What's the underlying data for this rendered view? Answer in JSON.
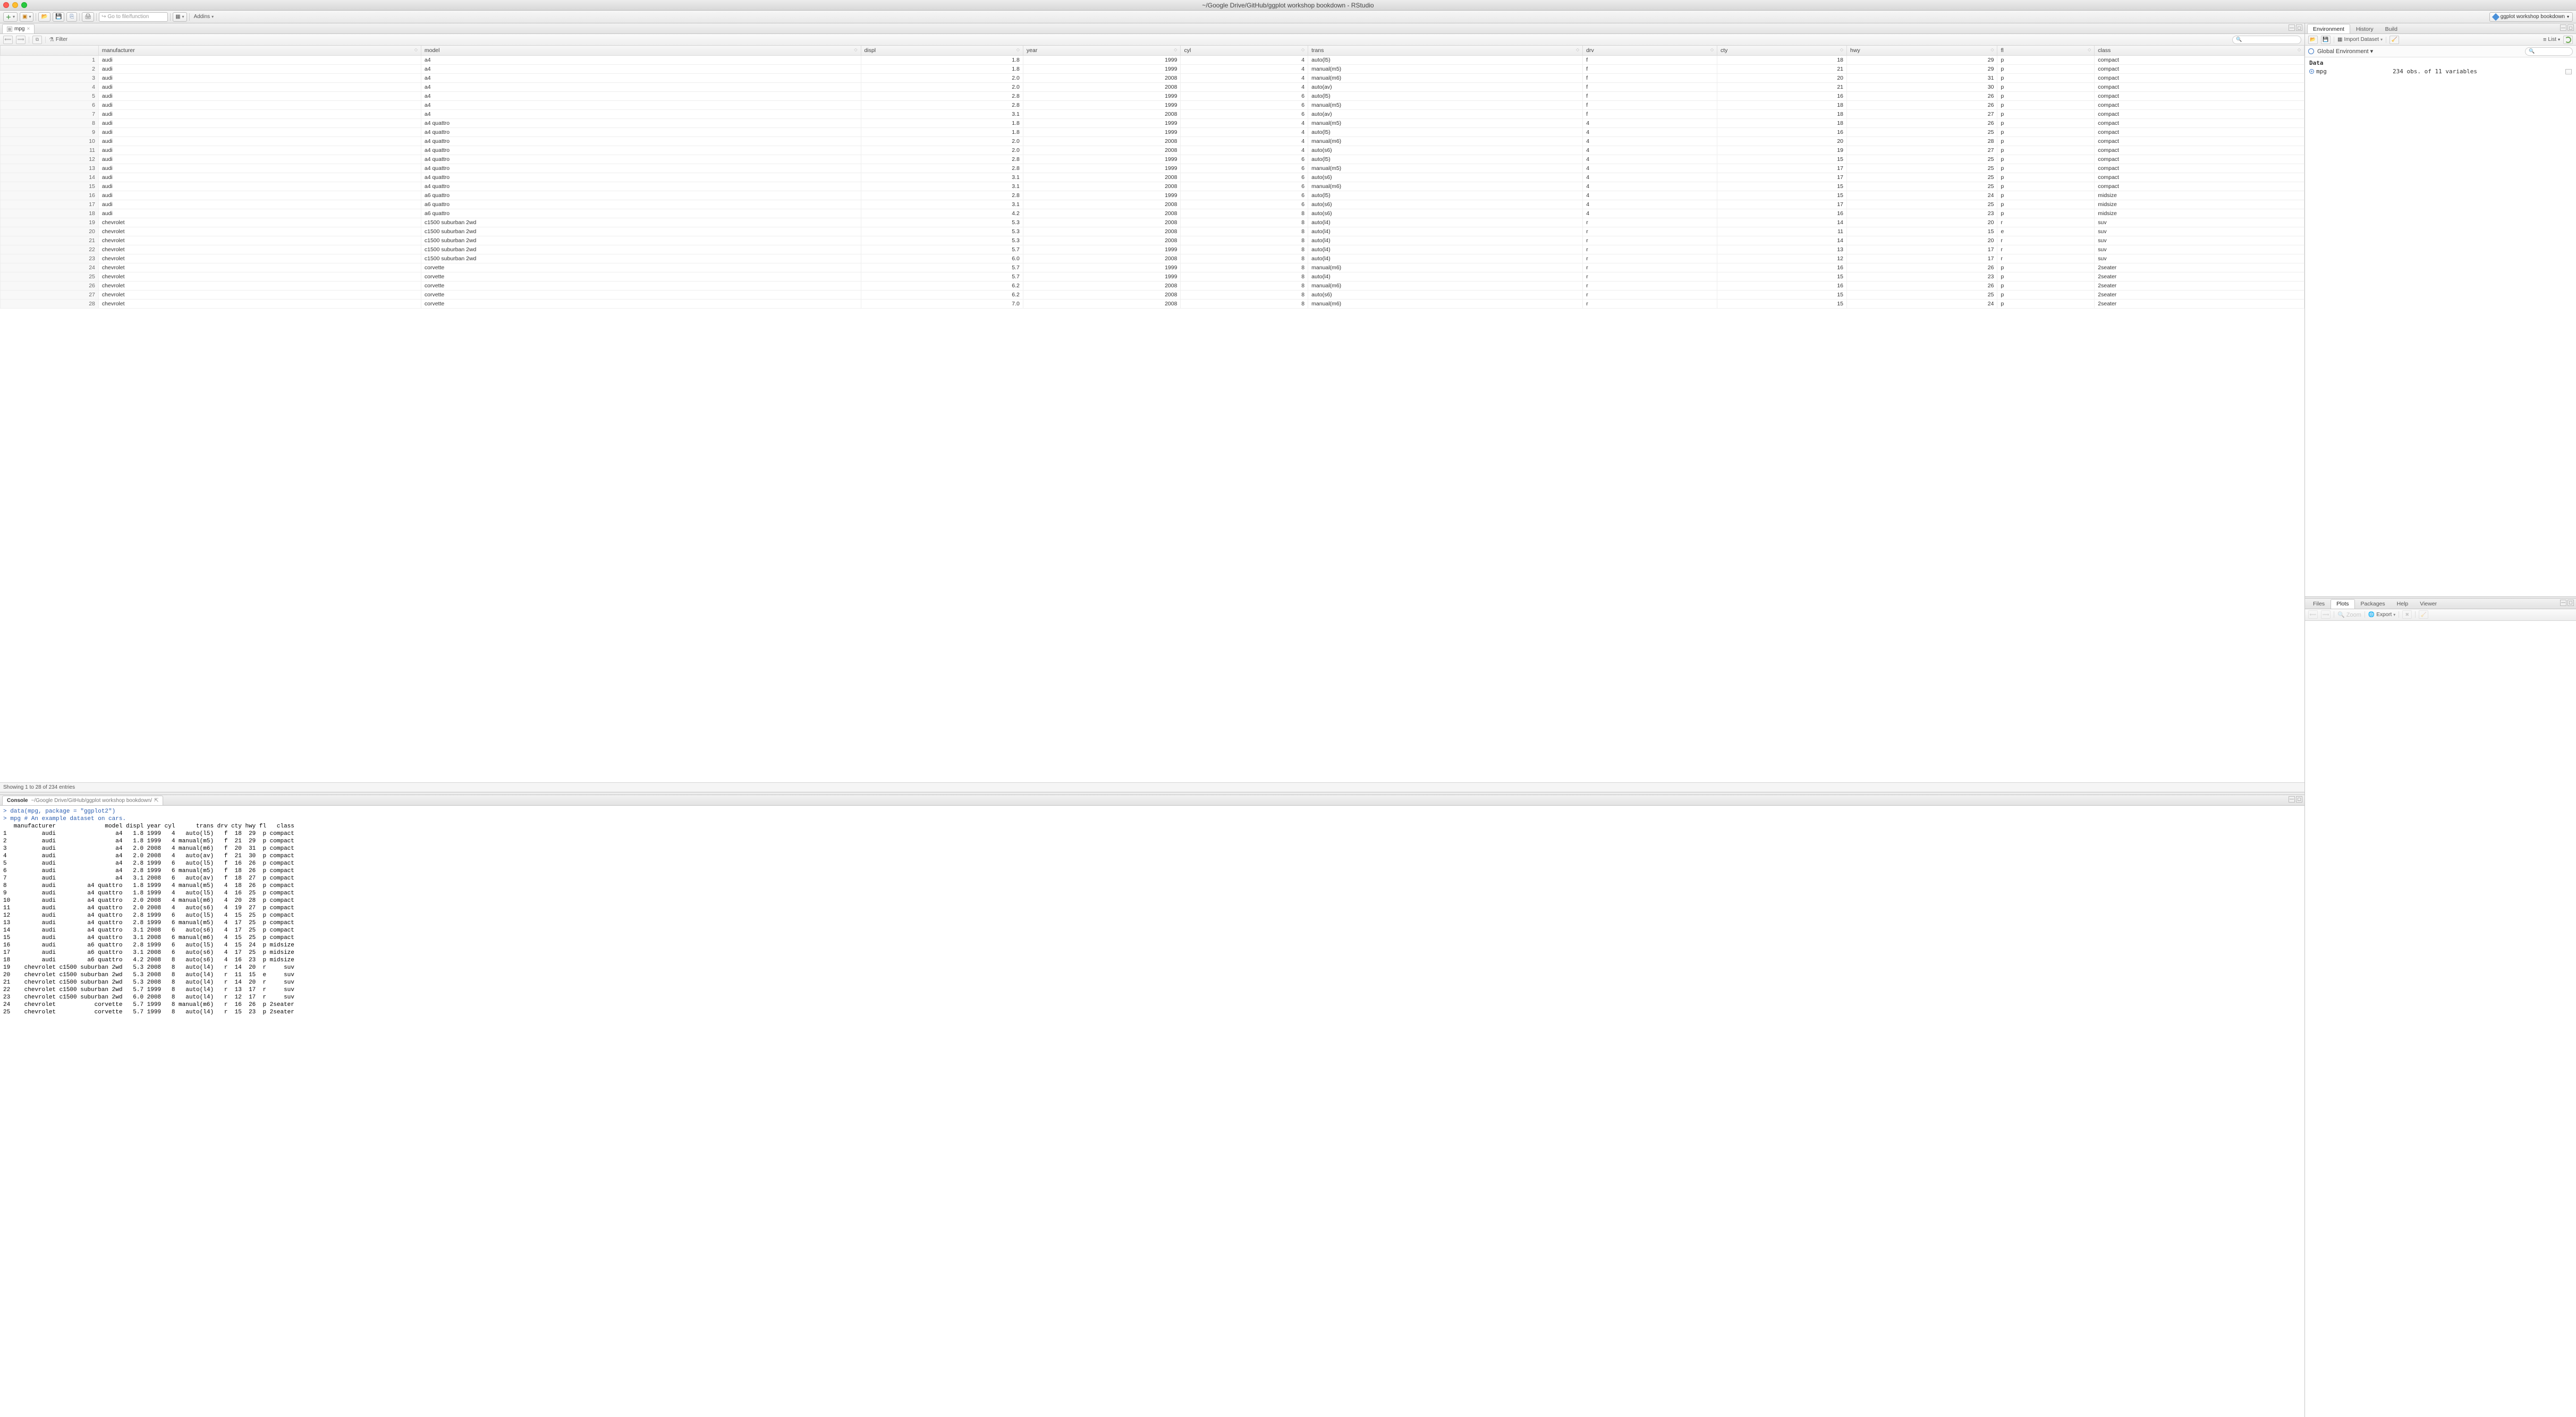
{
  "window": {
    "title": "~/Google Drive/GitHub/ggplot workshop bookdown - RStudio",
    "project": "ggplot workshop bookdown"
  },
  "toolbar": {
    "goto_placeholder": "Go to file/function",
    "addins": "Addins"
  },
  "source": {
    "tab_name": "mpg",
    "filter_label": "Filter",
    "footer": "Showing 1 to 28 of 234 entries",
    "headers": [
      "",
      "manufacturer",
      "model",
      "displ",
      "year",
      "cyl",
      "trans",
      "drv",
      "cty",
      "hwy",
      "fl",
      "class"
    ],
    "rows": [
      [
        1,
        "audi",
        "a4",
        "1.8",
        "1999",
        "4",
        "auto(l5)",
        "f",
        "18",
        "29",
        "p",
        "compact"
      ],
      [
        2,
        "audi",
        "a4",
        "1.8",
        "1999",
        "4",
        "manual(m5)",
        "f",
        "21",
        "29",
        "p",
        "compact"
      ],
      [
        3,
        "audi",
        "a4",
        "2.0",
        "2008",
        "4",
        "manual(m6)",
        "f",
        "20",
        "31",
        "p",
        "compact"
      ],
      [
        4,
        "audi",
        "a4",
        "2.0",
        "2008",
        "4",
        "auto(av)",
        "f",
        "21",
        "30",
        "p",
        "compact"
      ],
      [
        5,
        "audi",
        "a4",
        "2.8",
        "1999",
        "6",
        "auto(l5)",
        "f",
        "16",
        "26",
        "p",
        "compact"
      ],
      [
        6,
        "audi",
        "a4",
        "2.8",
        "1999",
        "6",
        "manual(m5)",
        "f",
        "18",
        "26",
        "p",
        "compact"
      ],
      [
        7,
        "audi",
        "a4",
        "3.1",
        "2008",
        "6",
        "auto(av)",
        "f",
        "18",
        "27",
        "p",
        "compact"
      ],
      [
        8,
        "audi",
        "a4 quattro",
        "1.8",
        "1999",
        "4",
        "manual(m5)",
        "4",
        "18",
        "26",
        "p",
        "compact"
      ],
      [
        9,
        "audi",
        "a4 quattro",
        "1.8",
        "1999",
        "4",
        "auto(l5)",
        "4",
        "16",
        "25",
        "p",
        "compact"
      ],
      [
        10,
        "audi",
        "a4 quattro",
        "2.0",
        "2008",
        "4",
        "manual(m6)",
        "4",
        "20",
        "28",
        "p",
        "compact"
      ],
      [
        11,
        "audi",
        "a4 quattro",
        "2.0",
        "2008",
        "4",
        "auto(s6)",
        "4",
        "19",
        "27",
        "p",
        "compact"
      ],
      [
        12,
        "audi",
        "a4 quattro",
        "2.8",
        "1999",
        "6",
        "auto(l5)",
        "4",
        "15",
        "25",
        "p",
        "compact"
      ],
      [
        13,
        "audi",
        "a4 quattro",
        "2.8",
        "1999",
        "6",
        "manual(m5)",
        "4",
        "17",
        "25",
        "p",
        "compact"
      ],
      [
        14,
        "audi",
        "a4 quattro",
        "3.1",
        "2008",
        "6",
        "auto(s6)",
        "4",
        "17",
        "25",
        "p",
        "compact"
      ],
      [
        15,
        "audi",
        "a4 quattro",
        "3.1",
        "2008",
        "6",
        "manual(m6)",
        "4",
        "15",
        "25",
        "p",
        "compact"
      ],
      [
        16,
        "audi",
        "a6 quattro",
        "2.8",
        "1999",
        "6",
        "auto(l5)",
        "4",
        "15",
        "24",
        "p",
        "midsize"
      ],
      [
        17,
        "audi",
        "a6 quattro",
        "3.1",
        "2008",
        "6",
        "auto(s6)",
        "4",
        "17",
        "25",
        "p",
        "midsize"
      ],
      [
        18,
        "audi",
        "a6 quattro",
        "4.2",
        "2008",
        "8",
        "auto(s6)",
        "4",
        "16",
        "23",
        "p",
        "midsize"
      ],
      [
        19,
        "chevrolet",
        "c1500 suburban 2wd",
        "5.3",
        "2008",
        "8",
        "auto(l4)",
        "r",
        "14",
        "20",
        "r",
        "suv"
      ],
      [
        20,
        "chevrolet",
        "c1500 suburban 2wd",
        "5.3",
        "2008",
        "8",
        "auto(l4)",
        "r",
        "11",
        "15",
        "e",
        "suv"
      ],
      [
        21,
        "chevrolet",
        "c1500 suburban 2wd",
        "5.3",
        "2008",
        "8",
        "auto(l4)",
        "r",
        "14",
        "20",
        "r",
        "suv"
      ],
      [
        22,
        "chevrolet",
        "c1500 suburban 2wd",
        "5.7",
        "1999",
        "8",
        "auto(l4)",
        "r",
        "13",
        "17",
        "r",
        "suv"
      ],
      [
        23,
        "chevrolet",
        "c1500 suburban 2wd",
        "6.0",
        "2008",
        "8",
        "auto(l4)",
        "r",
        "12",
        "17",
        "r",
        "suv"
      ],
      [
        24,
        "chevrolet",
        "corvette",
        "5.7",
        "1999",
        "8",
        "manual(m6)",
        "r",
        "16",
        "26",
        "p",
        "2seater"
      ],
      [
        25,
        "chevrolet",
        "corvette",
        "5.7",
        "1999",
        "8",
        "auto(l4)",
        "r",
        "15",
        "23",
        "p",
        "2seater"
      ],
      [
        26,
        "chevrolet",
        "corvette",
        "6.2",
        "2008",
        "8",
        "manual(m6)",
        "r",
        "16",
        "26",
        "p",
        "2seater"
      ],
      [
        27,
        "chevrolet",
        "corvette",
        "6.2",
        "2008",
        "8",
        "auto(s6)",
        "r",
        "15",
        "25",
        "p",
        "2seater"
      ],
      [
        28,
        "chevrolet",
        "corvette",
        "7.0",
        "2008",
        "8",
        "manual(m6)",
        "r",
        "15",
        "24",
        "p",
        "2seater"
      ]
    ]
  },
  "console": {
    "tab": "Console",
    "path": "~/Google Drive/GitHub/ggplot workshop bookdown/",
    "lines": [
      {
        "t": "cmd",
        "s": "> data(mpg, package = \"ggplot2\")"
      },
      {
        "t": "cmd",
        "s": "> mpg # An example dataset on cars."
      },
      {
        "t": "out",
        "s": "   manufacturer              model displ year cyl      trans drv cty hwy fl   class"
      },
      {
        "t": "out",
        "s": "1          audi                 a4   1.8 1999   4   auto(l5)   f  18  29  p compact"
      },
      {
        "t": "out",
        "s": "2          audi                 a4   1.8 1999   4 manual(m5)   f  21  29  p compact"
      },
      {
        "t": "out",
        "s": "3          audi                 a4   2.0 2008   4 manual(m6)   f  20  31  p compact"
      },
      {
        "t": "out",
        "s": "4          audi                 a4   2.0 2008   4   auto(av)   f  21  30  p compact"
      },
      {
        "t": "out",
        "s": "5          audi                 a4   2.8 1999   6   auto(l5)   f  16  26  p compact"
      },
      {
        "t": "out",
        "s": "6          audi                 a4   2.8 1999   6 manual(m5)   f  18  26  p compact"
      },
      {
        "t": "out",
        "s": "7          audi                 a4   3.1 2008   6   auto(av)   f  18  27  p compact"
      },
      {
        "t": "out",
        "s": "8          audi         a4 quattro   1.8 1999   4 manual(m5)   4  18  26  p compact"
      },
      {
        "t": "out",
        "s": "9          audi         a4 quattro   1.8 1999   4   auto(l5)   4  16  25  p compact"
      },
      {
        "t": "out",
        "s": "10         audi         a4 quattro   2.0 2008   4 manual(m6)   4  20  28  p compact"
      },
      {
        "t": "out",
        "s": "11         audi         a4 quattro   2.0 2008   4   auto(s6)   4  19  27  p compact"
      },
      {
        "t": "out",
        "s": "12         audi         a4 quattro   2.8 1999   6   auto(l5)   4  15  25  p compact"
      },
      {
        "t": "out",
        "s": "13         audi         a4 quattro   2.8 1999   6 manual(m5)   4  17  25  p compact"
      },
      {
        "t": "out",
        "s": "14         audi         a4 quattro   3.1 2008   6   auto(s6)   4  17  25  p compact"
      },
      {
        "t": "out",
        "s": "15         audi         a4 quattro   3.1 2008   6 manual(m6)   4  15  25  p compact"
      },
      {
        "t": "out",
        "s": "16         audi         a6 quattro   2.8 1999   6   auto(l5)   4  15  24  p midsize"
      },
      {
        "t": "out",
        "s": "17         audi         a6 quattro   3.1 2008   6   auto(s6)   4  17  25  p midsize"
      },
      {
        "t": "out",
        "s": "18         audi         a6 quattro   4.2 2008   8   auto(s6)   4  16  23  p midsize"
      },
      {
        "t": "out",
        "s": "19    chevrolet c1500 suburban 2wd   5.3 2008   8   auto(l4)   r  14  20  r     suv"
      },
      {
        "t": "out",
        "s": "20    chevrolet c1500 suburban 2wd   5.3 2008   8   auto(l4)   r  11  15  e     suv"
      },
      {
        "t": "out",
        "s": "21    chevrolet c1500 suburban 2wd   5.3 2008   8   auto(l4)   r  14  20  r     suv"
      },
      {
        "t": "out",
        "s": "22    chevrolet c1500 suburban 2wd   5.7 1999   8   auto(l4)   r  13  17  r     suv"
      },
      {
        "t": "out",
        "s": "23    chevrolet c1500 suburban 2wd   6.0 2008   8   auto(l4)   r  12  17  r     suv"
      },
      {
        "t": "out",
        "s": "24    chevrolet           corvette   5.7 1999   8 manual(m6)   r  16  26  p 2seater"
      },
      {
        "t": "out",
        "s": "25    chevrolet           corvette   5.7 1999   8   auto(l4)   r  15  23  p 2seater"
      }
    ]
  },
  "env": {
    "tabs": [
      "Environment",
      "History",
      "Build"
    ],
    "import": "Import Dataset",
    "scope": "Global Environment",
    "listmode": "List",
    "section": "Data",
    "items": [
      {
        "name": "mpg",
        "desc": "234 obs. of  11 variables"
      }
    ]
  },
  "plots": {
    "tabs": [
      "Files",
      "Plots",
      "Packages",
      "Help",
      "Viewer"
    ],
    "zoom": "Zoom",
    "export": "Export"
  }
}
